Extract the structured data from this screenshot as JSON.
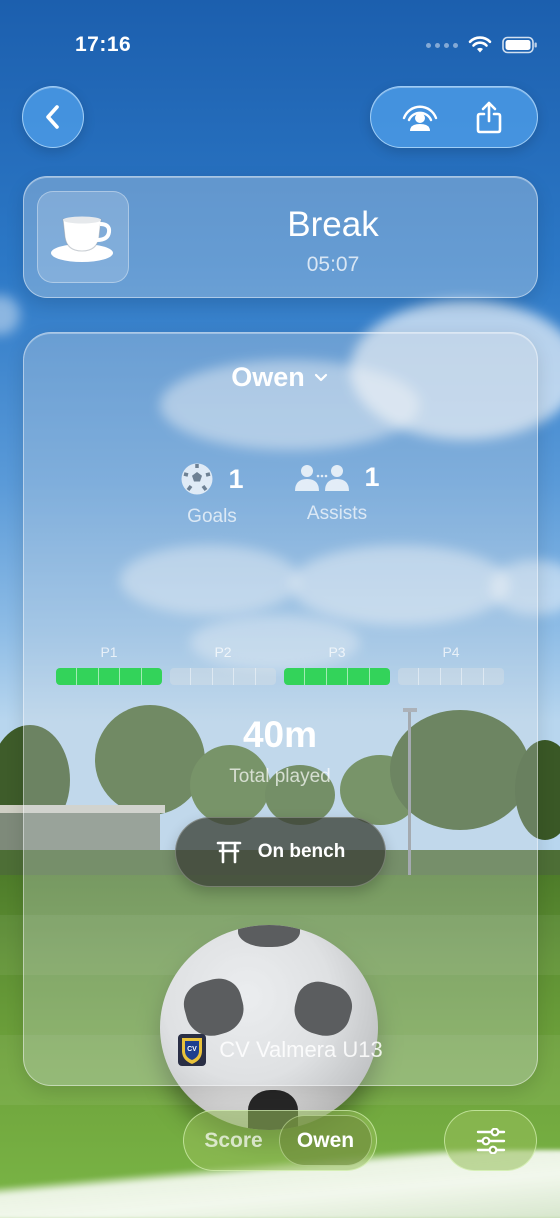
{
  "status_bar": {
    "time": "17:16"
  },
  "nav": {
    "back_icon": "chevron-left-icon",
    "actions": [
      "people-signal-icon",
      "share-icon"
    ]
  },
  "break_card": {
    "icon": "coffee-cup-icon",
    "title": "Break",
    "time": "05:07"
  },
  "player": {
    "name": "Owen",
    "stats": [
      {
        "icon": "soccer-ball-icon",
        "value": "1",
        "label": "Goals"
      },
      {
        "icon": "assist-icon",
        "value": "1",
        "label": "Assists"
      }
    ],
    "periods": [
      {
        "label": "P1",
        "played": true
      },
      {
        "label": "P2",
        "played": false
      },
      {
        "label": "P3",
        "played": true
      },
      {
        "label": "P4",
        "played": false
      }
    ],
    "total_value": "40m",
    "total_label": "Total played",
    "bench_button": "On bench",
    "team_name": "CV Valmera U13"
  },
  "bottom_bar": {
    "tabs": [
      "Score",
      "Owen"
    ],
    "active_tab": "Owen",
    "filter_icon": "sliders-icon"
  },
  "colors": {
    "played_green": "#33d35a",
    "accent_blue": "#50a0eb"
  }
}
